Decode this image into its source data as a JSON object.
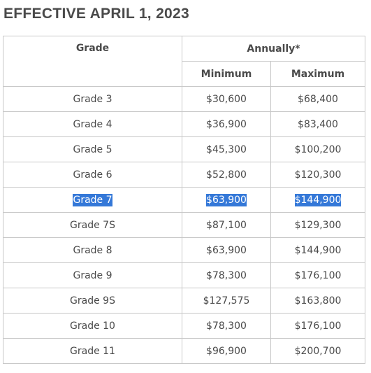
{
  "heading": "EFFECTIVE APRIL 1, 2023",
  "table": {
    "headers": {
      "grade": "Grade",
      "annually": "Annually*",
      "minimum": "Minimum",
      "maximum": "Maximum"
    },
    "rows": [
      {
        "grade": "Grade 3",
        "minimum": "$30,600",
        "maximum": "$68,400"
      },
      {
        "grade": "Grade 4",
        "minimum": "$36,900",
        "maximum": "$83,400"
      },
      {
        "grade": "Grade 5",
        "minimum": "$45,300",
        "maximum": "$100,200"
      },
      {
        "grade": "Grade 6",
        "minimum": "$52,800",
        "maximum": "$120,300"
      },
      {
        "grade": "Grade 7",
        "minimum": "$63,900",
        "maximum": "$144,900",
        "selected": true
      },
      {
        "grade": "Grade 7S",
        "minimum": "$87,100",
        "maximum": "$129,300"
      },
      {
        "grade": "Grade 8",
        "minimum": "$63,900",
        "maximum": "$144,900"
      },
      {
        "grade": "Grade 9",
        "minimum": "$78,300",
        "maximum": "$176,100"
      },
      {
        "grade": "Grade 9S",
        "minimum": "$127,575",
        "maximum": "$163,800"
      },
      {
        "grade": "Grade 10",
        "minimum": "$78,300",
        "maximum": "$176,100"
      },
      {
        "grade": "Grade 11",
        "minimum": "$96,900",
        "maximum": "$200,700"
      }
    ]
  },
  "colors": {
    "text": "#4a4a4a",
    "border": "#c8c8c8",
    "selection_background": "#3478d8",
    "selection_text": "#ffffff"
  }
}
